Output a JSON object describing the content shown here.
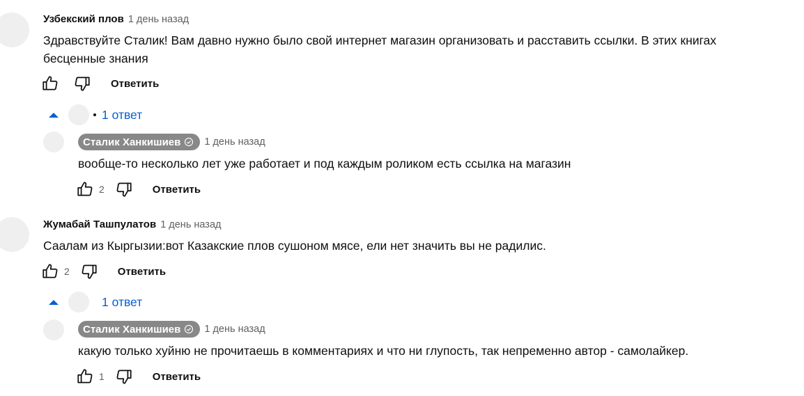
{
  "comments": [
    {
      "author": "Узбекский плов",
      "time": "1 день назад",
      "text": "Здравствуйте Сталик! Вам давно нужно было свой интернет магазин организовать и расставить ссылки. В этих книгах бесценные знания",
      "likes": "",
      "reply_label": "Ответить",
      "replies_label": "1 ответ",
      "reply": {
        "author": "Сталик Ханкишиев",
        "time": "1 день назад",
        "text": "вообще-то несколько лет уже работает и под каждым роликом есть ссылка на магазин",
        "likes": "2",
        "reply_label": "Ответить"
      }
    },
    {
      "author": "Жумабай Ташпулатов",
      "time": "1 день назад",
      "text": "Саалам из Кыргызии:вот Казакские плов сушоном мясе, ели нет значить вы не радилис.",
      "likes": "2",
      "reply_label": "Ответить",
      "replies_label": "1 ответ",
      "reply": {
        "author": "Сталик Ханкишиев",
        "time": "1 день назад",
        "text": "какую только хуйню не прочитаешь в комментариях и что ни глупость, так непременно автор - самолайкер.",
        "likes": "1",
        "reply_label": "Ответить"
      }
    }
  ],
  "colors": {
    "link": "#065fd4",
    "owner_chip": "#888888",
    "secondary_text": "#606060"
  },
  "icons": [
    "thumb-up-icon",
    "thumb-down-icon",
    "caret-up-icon",
    "verified-check-icon"
  ]
}
